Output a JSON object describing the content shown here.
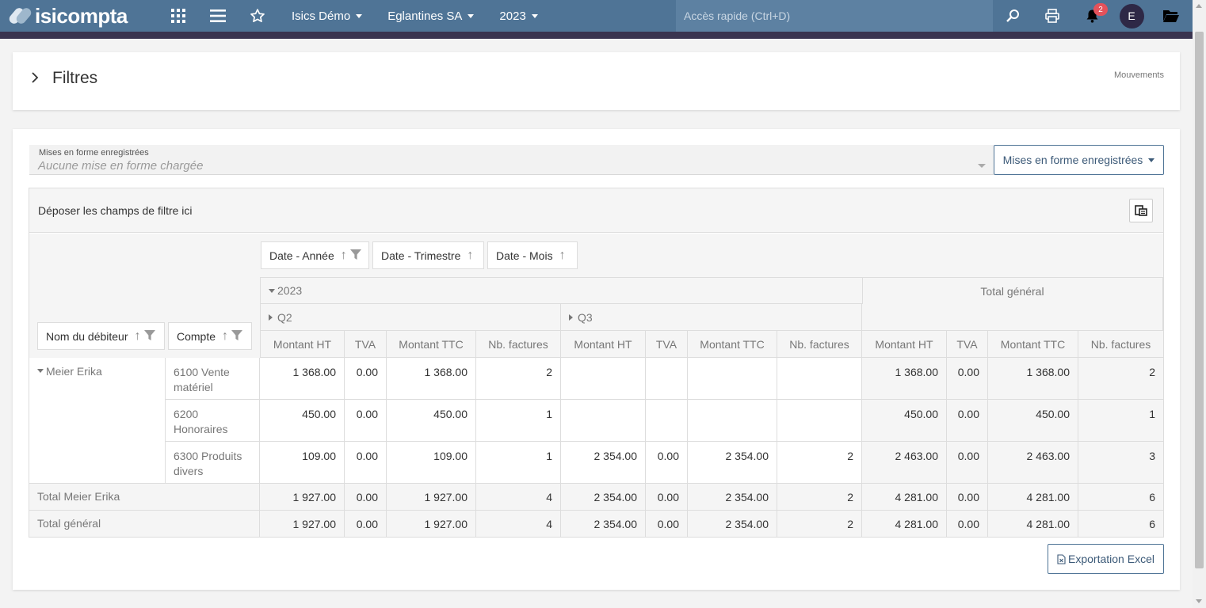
{
  "topbar": {
    "logo_text": "isicompta",
    "company_menu": "Isics Démo",
    "entity_menu": "Eglantines SA",
    "year_menu": "2023",
    "quick_access_placeholder": "Accès rapide (Ctrl+D)",
    "notifications_count": "2",
    "avatar_initial": "E"
  },
  "filters": {
    "title": "Filtres",
    "link": "Mouvements"
  },
  "saved_formats": {
    "label": "Mises en forme enregistrées",
    "value": "Aucune mise en forme chargée",
    "button": "Mises en forme enregistrées"
  },
  "pivot": {
    "filter_drop_text": "Déposer les champs de filtre ici",
    "column_fields": [
      "Date - Année",
      "Date - Trimestre",
      "Date - Mois"
    ],
    "row_fields": [
      "Nom du débiteur",
      "Compte"
    ],
    "year": "2023",
    "quarters": [
      "Q2",
      "Q3"
    ],
    "grand_total_header": "Total général",
    "measures": [
      "Montant HT",
      "TVA",
      "Montant TTC",
      "Nb. factures"
    ],
    "debtor": "Meier Erika",
    "rows": [
      {
        "account_line1": "6100 Vente",
        "account_line2": "matériel",
        "q2": [
          "1 368.00",
          "0.00",
          "1 368.00",
          "2"
        ],
        "q3": [
          "",
          "",
          "",
          ""
        ],
        "total": [
          "1 368.00",
          "0.00",
          "1 368.00",
          "2"
        ]
      },
      {
        "account_line1": "6200",
        "account_line2": "Honoraires",
        "q2": [
          "450.00",
          "0.00",
          "450.00",
          "1"
        ],
        "q3": [
          "",
          "",
          "",
          ""
        ],
        "total": [
          "450.00",
          "0.00",
          "450.00",
          "1"
        ]
      },
      {
        "account_line1": "6300 Produits",
        "account_line2": "divers",
        "q2": [
          "109.00",
          "0.00",
          "109.00",
          "1"
        ],
        "q3": [
          "2 354.00",
          "0.00",
          "2 354.00",
          "2"
        ],
        "total": [
          "2 463.00",
          "0.00",
          "2 463.00",
          "3"
        ]
      }
    ],
    "subtotal": {
      "label": "Total Meier Erika",
      "q2": [
        "1 927.00",
        "0.00",
        "1 927.00",
        "4"
      ],
      "q3": [
        "2 354.00",
        "0.00",
        "2 354.00",
        "2"
      ],
      "total": [
        "4 281.00",
        "0.00",
        "4 281.00",
        "6"
      ]
    },
    "grandtotal": {
      "label": "Total général",
      "q2": [
        "1 927.00",
        "0.00",
        "1 927.00",
        "4"
      ],
      "q3": [
        "2 354.00",
        "0.00",
        "2 354.00",
        "2"
      ],
      "total": [
        "4 281.00",
        "0.00",
        "4 281.00",
        "6"
      ]
    }
  },
  "export_button": "Exportation Excel"
}
